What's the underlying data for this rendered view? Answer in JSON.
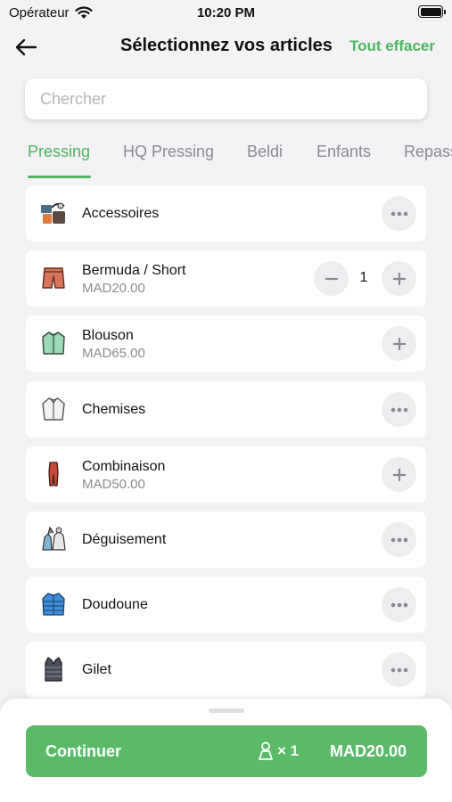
{
  "status_bar": {
    "carrier": "Opérateur",
    "time": "10:20 PM"
  },
  "nav": {
    "title": "Sélectionnez vos articles",
    "clear_label": "Tout effacer"
  },
  "search": {
    "placeholder": "Chercher"
  },
  "tabs": [
    {
      "label": "Pressing",
      "active": true
    },
    {
      "label": "HQ Pressing"
    },
    {
      "label": "Beldi"
    },
    {
      "label": "Enfants"
    },
    {
      "label": "Repassage"
    }
  ],
  "items": [
    {
      "name": "Accessoires",
      "icon": "accessories-icon",
      "action": "more"
    },
    {
      "name": "Bermuda / Short",
      "price": "MAD20.00",
      "icon": "shorts-icon",
      "action": "stepper",
      "quantity": "1"
    },
    {
      "name": "Blouson",
      "price": "MAD65.00",
      "icon": "jacket-icon",
      "action": "add"
    },
    {
      "name": "Chemises",
      "icon": "shirt-icon",
      "action": "more"
    },
    {
      "name": "Combinaison",
      "price": "MAD50.00",
      "icon": "jumpsuit-icon",
      "action": "add"
    },
    {
      "name": "Déguisement",
      "icon": "costume-icon",
      "action": "more"
    },
    {
      "name": "Doudoune",
      "icon": "down-jacket-icon",
      "action": "more"
    },
    {
      "name": "Gilet",
      "icon": "vest-icon",
      "action": "more"
    }
  ],
  "footer": {
    "continue_label": "Continuer",
    "count": "× 1",
    "total": "MAD20.00"
  },
  "colors": {
    "accent": "#4cb55d",
    "button": "#5bba68",
    "background": "#f3f3f5"
  }
}
